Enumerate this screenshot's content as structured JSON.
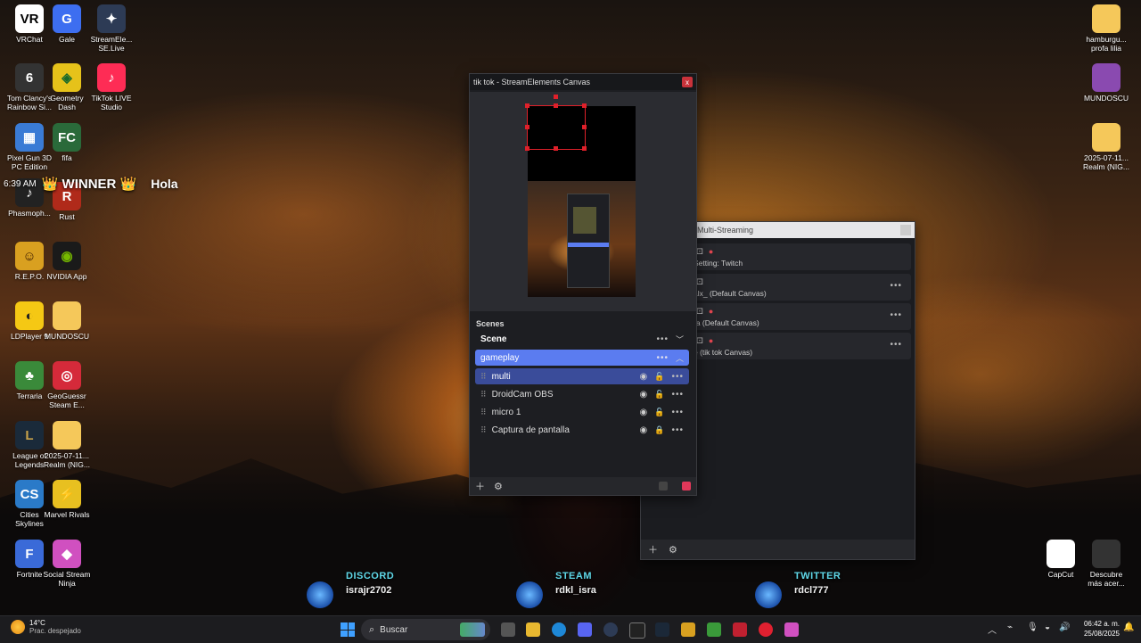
{
  "desktop": {
    "icons": [
      {
        "label": "VRChat",
        "icon": "vrchat-icon",
        "color": "#ffffff",
        "fg": "#000000",
        "glyph": "VR"
      },
      {
        "label": "Gale",
        "icon": "gale-icon",
        "color": "#3d6ef0",
        "fg": "#ffffff",
        "glyph": "G"
      },
      {
        "label": "StreamEle...\nSE.Live",
        "icon": "streamelements-icon",
        "color": "#2d3b55",
        "fg": "#ffffff",
        "glyph": "✦"
      },
      {
        "label": "Tom Clancy's\nRainbow Si...",
        "icon": "rainbow-six-icon",
        "color": "#333333",
        "fg": "#ffffff",
        "glyph": "6"
      },
      {
        "label": "Geometry\nDash",
        "icon": "geometry-dash-icon",
        "color": "#e6c21a",
        "fg": "#1a6a2a",
        "glyph": "◈"
      },
      {
        "label": "TikTok LIVE\nStudio",
        "icon": "tiktok-live-icon",
        "color": "#fe2c55",
        "fg": "#ffffff",
        "glyph": "♪"
      },
      {
        "label": "Pixel Gun 3D\nPC Edition",
        "icon": "pixel-gun-icon",
        "color": "#3a7bd5",
        "fg": "#ffffff",
        "glyph": "▦"
      },
      {
        "label": "fifa",
        "icon": "fifa-icon",
        "color": "#2a6a3a",
        "fg": "#ffffff",
        "glyph": "FC"
      },
      {
        "label": "Phasmoph...",
        "icon": "phasmophobia-icon",
        "color": "#222222",
        "fg": "#ffffff",
        "glyph": "♪"
      },
      {
        "label": "Rust",
        "icon": "rust-icon",
        "color": "#b02a1a",
        "fg": "#ffffff",
        "glyph": "R"
      },
      {
        "label": "R.E.P.O.",
        "icon": "repo-icon",
        "color": "#d9a020",
        "fg": "#3a1a00",
        "glyph": "☺"
      },
      {
        "label": "NVIDIA App",
        "icon": "nvidia-icon",
        "color": "#1a1a1a",
        "fg": "#76b900",
        "glyph": "◉"
      },
      {
        "label": "LDPlayer 9",
        "icon": "ldplayer-icon",
        "color": "#f5c814",
        "fg": "#222222",
        "glyph": "◐"
      },
      {
        "label": "MUNDOSCU",
        "icon": "folder-icon",
        "color": "#f5c85a",
        "fg": "#f5c85a",
        "glyph": ""
      },
      {
        "label": "Terraria",
        "icon": "terraria-icon",
        "color": "#3a8a3a",
        "fg": "#ffffff",
        "glyph": "♣"
      },
      {
        "label": "GeoGuessr\nSteam E...",
        "icon": "geoguessr-icon",
        "color": "#d52a3a",
        "fg": "#ffffff",
        "glyph": "◎"
      },
      {
        "label": "League of\nLegends",
        "icon": "league-icon",
        "color": "#1a2a3a",
        "fg": "#c8a24a",
        "glyph": "L"
      },
      {
        "label": "2025-07-11...\nRealm (NIG...",
        "icon": "folder-icon",
        "color": "#f5c85a",
        "fg": "#f5c85a",
        "glyph": ""
      },
      {
        "label": "Cities\nSkylines",
        "icon": "cities-skylines-icon",
        "color": "#2a7ac8",
        "fg": "#ffffff",
        "glyph": "CS"
      },
      {
        "label": "Marvel Rivals",
        "icon": "marvel-rivals-icon",
        "color": "#e8c020",
        "fg": "#1a1a5a",
        "glyph": "⚡"
      },
      {
        "label": "Fortnite",
        "icon": "fortnite-icon",
        "color": "#3a6ad8",
        "fg": "#ffffff",
        "glyph": "F"
      },
      {
        "label": "Social Stream\nNinja",
        "icon": "social-stream-ninja-icon",
        "color": "#d050c0",
        "fg": "#ffffff",
        "glyph": "◆"
      }
    ],
    "right_icons": [
      {
        "label": "hamburgu...\nprofa lilia",
        "icon": "folder-icon",
        "color": "#f5c85a"
      },
      {
        "label": "MUNDOSCU",
        "icon": "winrar-icon",
        "color": "#8a4ab0"
      },
      {
        "label": "2025-07-11...\nRealm (NIG...",
        "icon": "folder-icon",
        "color": "#f5c85a"
      },
      {
        "label": "CapCut",
        "icon": "capcut-icon",
        "color": "#ffffff"
      },
      {
        "label": "Descubre\nmás acer...",
        "icon": "discover-icon",
        "color": "#333333"
      }
    ],
    "overlay": {
      "time": "6:39 AM",
      "winner": "👑 WINNER 👑",
      "hola": "Hola"
    }
  },
  "canvas_window": {
    "title": "tik tok - StreamElements Canvas",
    "close_label": "x",
    "scenes_label": "Scenes",
    "scenes": [
      {
        "name": "Scene",
        "active": false
      },
      {
        "name": "gameplay",
        "active": true
      }
    ],
    "sources": [
      {
        "name": "multi",
        "selected": true
      },
      {
        "name": "DroidCam OBS",
        "selected": false
      },
      {
        "name": "micro 1",
        "selected": false
      },
      {
        "name": "Captura de pantalla",
        "selected": false
      }
    ],
    "accent": "#5b7cf0"
  },
  "multistream_window": {
    "title": "Multi-Streaming",
    "rows": [
      {
        "top": "⚀",
        "name": "Setting: Twitch"
      },
      {
        "top": "⚀",
        "name": "alx_ (Default Canvas)"
      },
      {
        "top": "⚀",
        "name": "ra (Default Canvas)"
      },
      {
        "top": "⚀",
        "name": "e (tik tok Canvas)"
      }
    ]
  },
  "socials": [
    {
      "heading": "DISCORD",
      "value": "israjr2702"
    },
    {
      "heading": "STEAM",
      "value": "rdkl_isra"
    },
    {
      "heading": "TWITTER",
      "value": "rdcl777"
    }
  ],
  "taskbar": {
    "weather_temp": "14°C",
    "weather_desc": "Prac. despejado",
    "search_placeholder": "Buscar",
    "time": "06:42 a. m.",
    "date": "25/08/2025"
  }
}
